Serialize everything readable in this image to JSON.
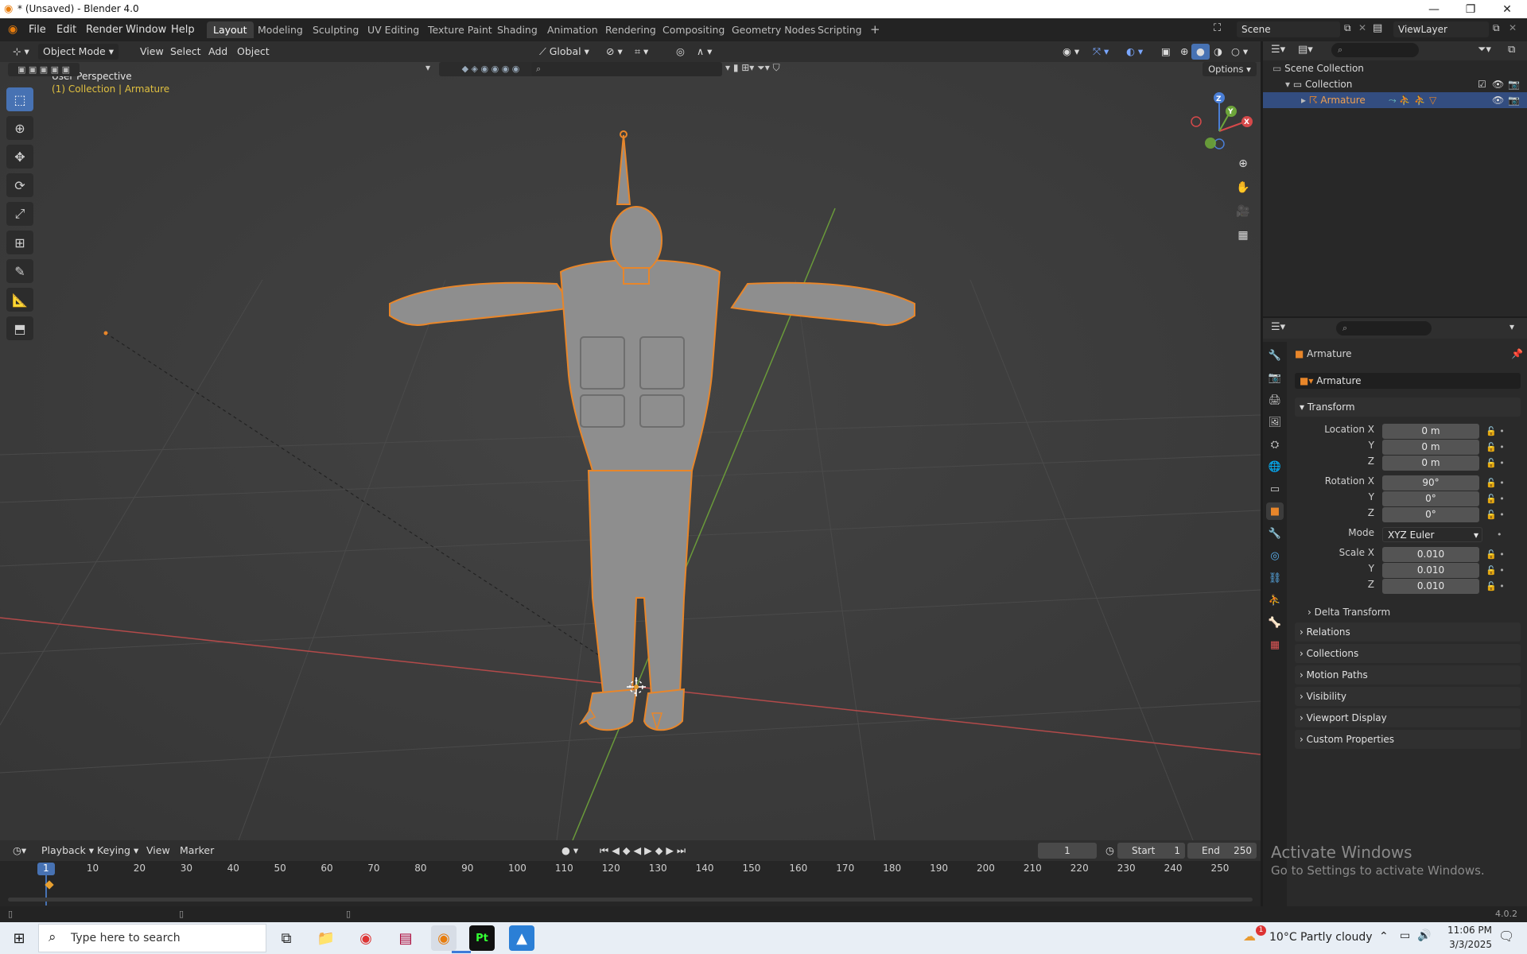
{
  "window": {
    "title": "* (Unsaved) - Blender 4.0",
    "minimize": "—",
    "maximize": "❐",
    "close": "✕"
  },
  "menu": [
    "File",
    "Edit",
    "Render",
    "Window",
    "Help"
  ],
  "workspaces": [
    "Layout",
    "Modeling",
    "Sculpting",
    "UV Editing",
    "Texture Paint",
    "Shading",
    "Animation",
    "Rendering",
    "Compositing",
    "Geometry Nodes",
    "Scripting"
  ],
  "scene": {
    "name": "Scene",
    "view_layer": "ViewLayer"
  },
  "viewport": {
    "mode": "Object Mode",
    "menus": [
      "View",
      "Select",
      "Add",
      "Object"
    ],
    "orientation": "Global",
    "options_label": "Options",
    "overlay_title": "User Perspective",
    "overlay_collection": "(1) Collection | Armature"
  },
  "gizmo": {
    "x": "X",
    "y": "Y",
    "z": "Z"
  },
  "outliner": {
    "root": "Scene Collection",
    "collection": "Collection",
    "object": "Armature"
  },
  "properties": {
    "object_name": "Armature",
    "data_name": "Armature",
    "transform_label": "Transform",
    "location_label": "Location X",
    "location": [
      "0 m",
      "0 m",
      "0 m"
    ],
    "rotation_label": "Rotation X",
    "rotation": [
      "90°",
      "0°",
      "0°"
    ],
    "mode_label": "Mode",
    "mode": "XYZ Euler",
    "scale_label": "Scale X",
    "scale": [
      "0.010",
      "0.010",
      "0.010"
    ],
    "axis_y": "Y",
    "axis_z": "Z",
    "delta": "Delta Transform",
    "panels": [
      "Relations",
      "Collections",
      "Motion Paths",
      "Visibility",
      "Viewport Display",
      "Custom Properties"
    ]
  },
  "timeline": {
    "menus": [
      "Playback",
      "Keying",
      "View",
      "Marker"
    ],
    "current_frame": "1",
    "start_label": "Start",
    "start": "1",
    "end_label": "End",
    "end": "250",
    "ticks": [
      "1",
      "10",
      "20",
      "30",
      "40",
      "50",
      "60",
      "70",
      "80",
      "90",
      "100",
      "110",
      "120",
      "130",
      "140",
      "150",
      "160",
      "170",
      "180",
      "190",
      "200",
      "210",
      "220",
      "230",
      "240",
      "250"
    ]
  },
  "activate": {
    "line1": "Activate Windows",
    "line2": "Go to Settings to activate Windows."
  },
  "version": "4.0.2",
  "taskbar": {
    "search_placeholder": "Type here to search",
    "weather": "10°C  Partly cloudy",
    "time": "11:06 PM",
    "date": "3/3/2025",
    "notif_count": "1"
  }
}
